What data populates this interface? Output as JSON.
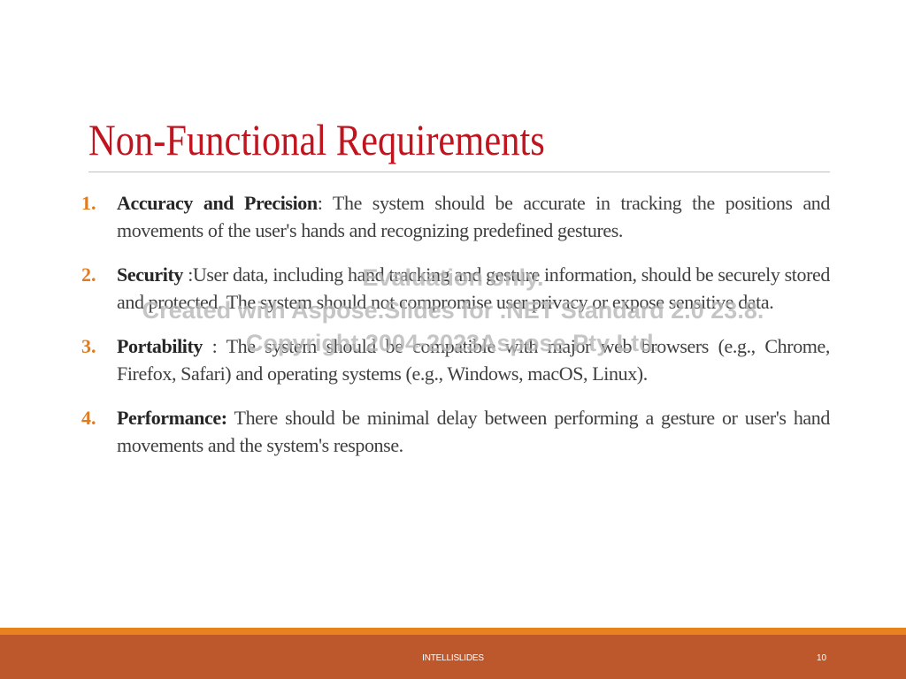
{
  "slide": {
    "title": "Non-Functional Requirements",
    "requirements": [
      {
        "number": "1.",
        "title": "Accuracy and Precision",
        "text": ": The system should be accurate in tracking the positions and movements of the user's hands and recognizing predefined gestures."
      },
      {
        "number": "2.",
        "title": "Security",
        "text": " :User data, including hand tracking and gesture information, should be securely stored and protected. The system should not compromise user privacy or expose sensitive data."
      },
      {
        "number": "3.",
        "title": "Portability",
        "text": " : The system should be compatible with major web browsers (e.g., Chrome, Firefox, Safari) and operating systems (e.g., Windows, macOS, Linux)."
      },
      {
        "number": "4.",
        "title": "Performance:",
        "text": " There should be minimal delay between performing a gesture or user's hand movements and the system's response."
      }
    ]
  },
  "watermark": {
    "line1": "Evaluation only.",
    "line2": "Created with Aspose.Slides for .NET Standard 2.0 23.8.",
    "line3": "Copyright 2004-2023Aspose Pty Ltd."
  },
  "footer": {
    "label": "INTELLISLIDES",
    "page_number": "10"
  },
  "colors": {
    "title": "#c0151f",
    "number": "#e07b20",
    "footer_stripe": "#e8821f",
    "footer_bar": "#bd582c"
  }
}
